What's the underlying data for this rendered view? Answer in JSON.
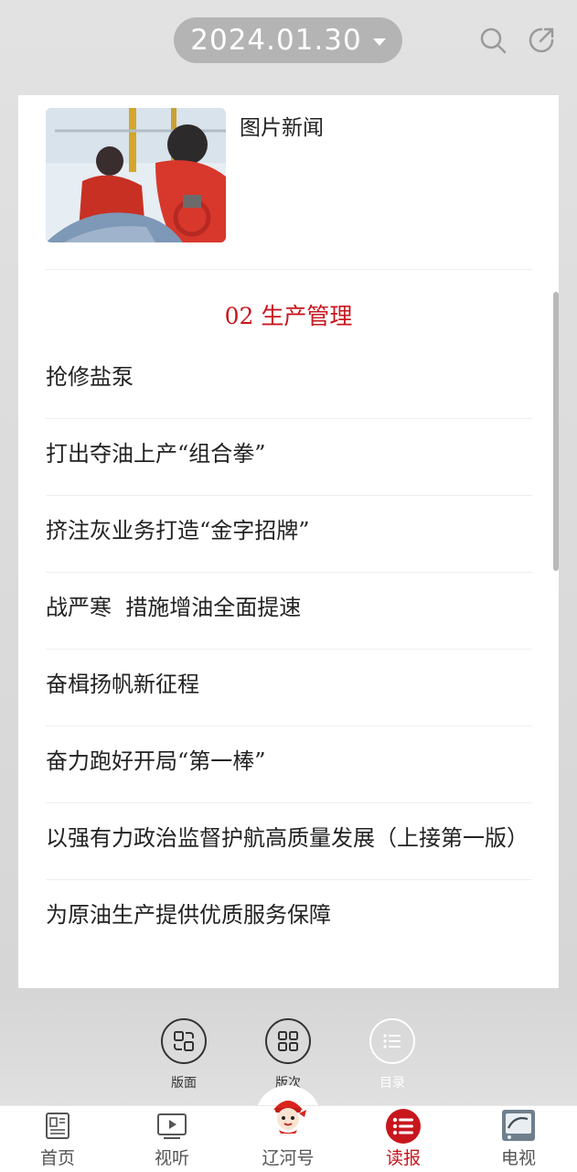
{
  "header": {
    "date": "2024.01.30",
    "search_icon": "search-icon",
    "share_icon": "share-icon"
  },
  "photo_news": {
    "title": "图片新闻"
  },
  "section": {
    "number": "02",
    "name": "生产管理"
  },
  "articles": [
    "抢修盐泵",
    "打出夺油上产“组合拳”",
    "挤注灰业务打造“金字招牌”",
    "战严寒  措施增油全面提速",
    "奋楫扬帆新征程",
    "奋力跑好开局“第一棒”",
    "以强有力政治监督护航高质量发展（上接第一版）",
    "为原油生产提供优质服务保障"
  ],
  "actions": {
    "layout": "版面",
    "edition": "版次",
    "catalog": "目录"
  },
  "tabs": [
    {
      "label": "首页",
      "icon": "newspaper-icon"
    },
    {
      "label": "视听",
      "icon": "play-icon"
    },
    {
      "label": "辽河号",
      "icon": "mascot-icon"
    },
    {
      "label": "读报",
      "icon": "list-icon"
    },
    {
      "label": "电视",
      "icon": "tv-icon"
    }
  ],
  "colors": {
    "accent": "#c8161d",
    "pill": "#b4b4b4"
  }
}
